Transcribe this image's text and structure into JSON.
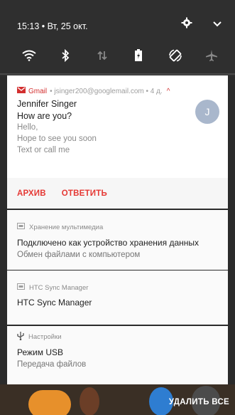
{
  "status_bar": {
    "time_date": "15:13 • Вт, 25 окт."
  },
  "quick_settings": {
    "icons": [
      "wifi-icon",
      "bluetooth-icon",
      "mobile-data-icon",
      "battery-saver-icon",
      "auto-rotate-icon",
      "airplane-mode-icon"
    ]
  },
  "gmail_notification": {
    "app_name": "Gmail",
    "account": "• jsinger200@googlemail.com • 4 д.",
    "sender": "Jennifer Singer",
    "subject": "How are you?",
    "body_lines": [
      "Hello,",
      "Hope to see you soon",
      "Text or call me"
    ],
    "avatar_letter": "J",
    "actions": [
      "АРХИВ",
      "ОТВЕТИТЬ"
    ],
    "accent_color": "#e53935"
  },
  "media_storage_notification": {
    "app_name": "Хранение мультимедиа",
    "title": "Подключено как устройство хранения данных",
    "text": "Обмен файлами с компьютером"
  },
  "htc_sync_notification": {
    "app_name": "HTC Sync Manager",
    "title": "HTC Sync Manager"
  },
  "usb_notification": {
    "app_name": "Настройки",
    "title": "Режим USB",
    "text": "Передача файлов"
  },
  "bottom_bar": {
    "clear_all_label": "УДАЛИТЬ ВСЕ"
  }
}
